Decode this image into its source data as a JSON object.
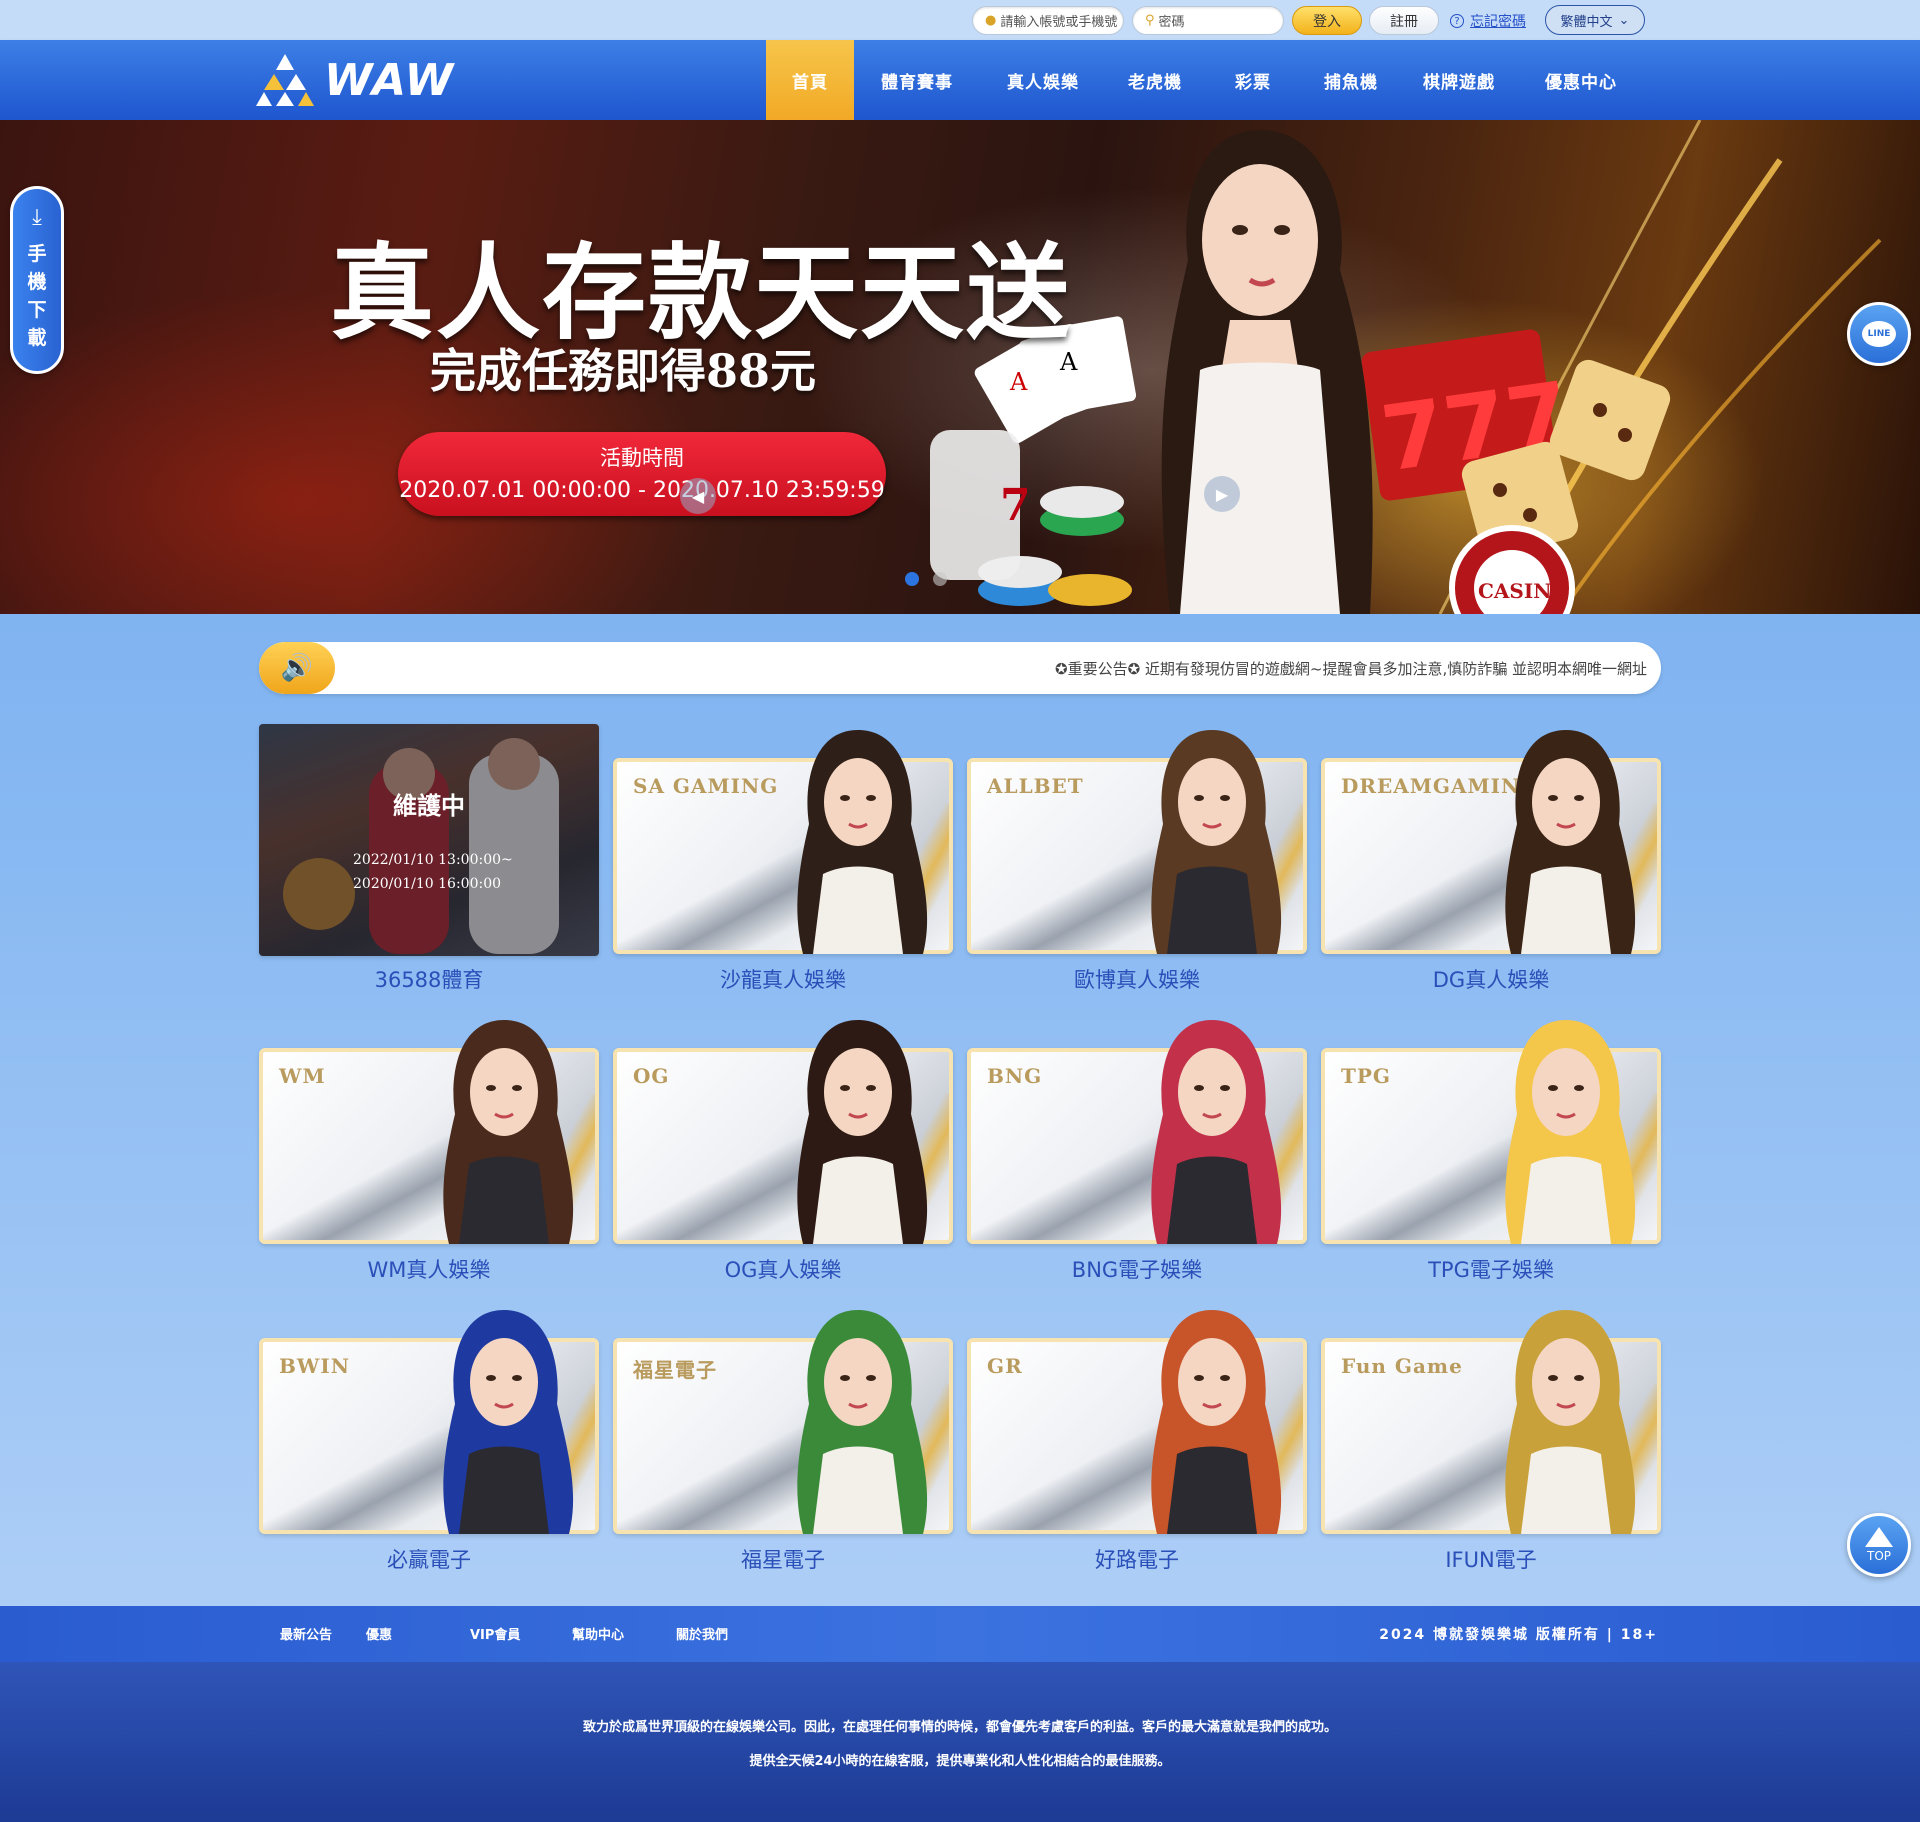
{
  "account": {
    "username_placeholder": "請輸入帳號或手機號",
    "password_placeholder": "密碼",
    "login_label": "登入",
    "register_label": "註冊",
    "forgot_label": "忘記密碼",
    "language": "繁體中文"
  },
  "header": {
    "logo_text": "WAW",
    "nav": [
      "首頁",
      "體育賽事",
      "真人娛樂",
      "老虎機",
      "彩票",
      "捕魚機",
      "棋牌遊戲",
      "優惠中心"
    ],
    "active_index": 0
  },
  "banner": {
    "title": "真人存款天天送",
    "subtitle": "完成任務即得88元",
    "pill_label": "活動時間",
    "pill_time": "2020.07.01  00:00:00 - 2020.07.10 23:59:59",
    "slide_count": 2,
    "active_slide": 0
  },
  "side": {
    "download_label": "手機下載",
    "line_label": "LINE",
    "top_label": "TOP"
  },
  "marquee": {
    "text": "✪重要公告✪ 近期有發現仿冒的遊戲網~提醒會員多加注意,慎防詐騙 並認明本網唯一網址"
  },
  "games": [
    {
      "label": "36588體育",
      "brand": "36588",
      "maintenance": true,
      "maint_title": "維護中",
      "maint_time1": "2022/01/10 13:00:00~",
      "maint_time2": "2020/01/10 16:00:00"
    },
    {
      "label": "沙龍真人娛樂",
      "brand": "SA GAMING"
    },
    {
      "label": "歐博真人娛樂",
      "brand": "ALLBET"
    },
    {
      "label": "DG真人娛樂",
      "brand": "DREAMGAMING"
    },
    {
      "label": "WM真人娛樂",
      "brand": "WM"
    },
    {
      "label": "OG真人娛樂",
      "brand": "OG"
    },
    {
      "label": "BNG電子娛樂",
      "brand": "BNG"
    },
    {
      "label": "TPG電子娛樂",
      "brand": "TPG"
    },
    {
      "label": "必贏電子",
      "brand": "BWIN"
    },
    {
      "label": "福星電子",
      "brand": "福星電子"
    },
    {
      "label": "好路電子",
      "brand": "GR"
    },
    {
      "label": "IFUN電子",
      "brand": "Fun Game"
    }
  ],
  "footer": {
    "links": [
      "最新公告",
      "優惠",
      "VIP會員",
      "幫助中心",
      "關於我們"
    ],
    "copyright": "2024 博就發娛樂城 版權所有 | 18+",
    "line1": "致力於成爲世界頂級的在線娛樂公司。因此，在處理任何事情的時候，都會優先考慮客戶的利益。客戶的最大滿意就是我們的成功。",
    "line2": "提供全天候24小時的在線客服，提供專業化和人性化相結合的最佳服務。"
  },
  "colors": {
    "nav_bg": "#1e56cf",
    "nav_active": "#f2a925",
    "page_bg": "#87b8f2",
    "accent_red": "#c9101f",
    "label_blue": "#2a4fb8"
  }
}
